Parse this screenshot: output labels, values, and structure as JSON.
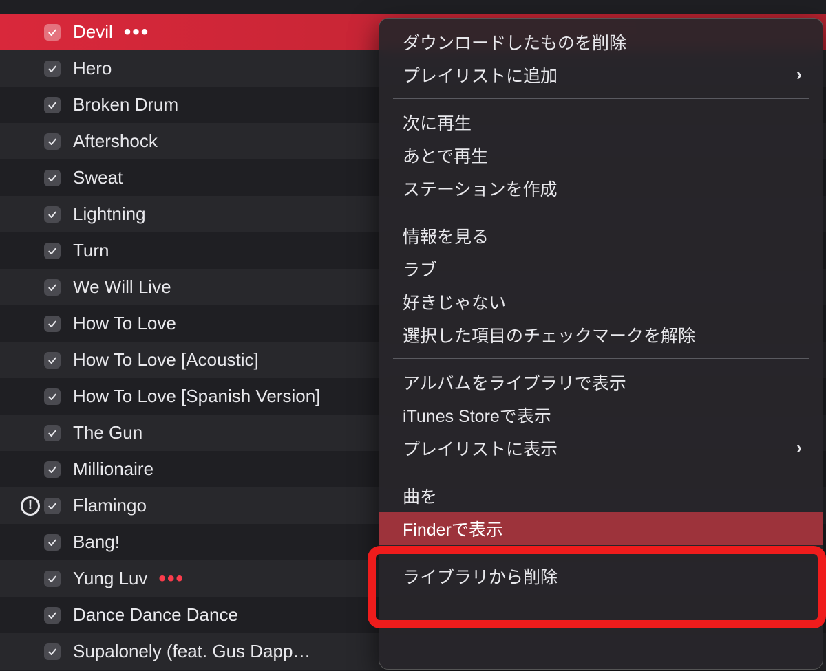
{
  "tracks": [
    {
      "title": "Devil",
      "checked": true,
      "selected": true,
      "ellipsis": true,
      "ellipsisRed": false,
      "warning": false
    },
    {
      "title": "Hero",
      "checked": true,
      "selected": false,
      "ellipsis": false,
      "warning": false
    },
    {
      "title": "Broken Drum",
      "checked": true,
      "selected": false,
      "ellipsis": false,
      "warning": false
    },
    {
      "title": "Aftershock",
      "checked": true,
      "selected": false,
      "ellipsis": false,
      "warning": false
    },
    {
      "title": "Sweat",
      "checked": true,
      "selected": false,
      "ellipsis": false,
      "warning": false
    },
    {
      "title": "Lightning",
      "checked": true,
      "selected": false,
      "ellipsis": false,
      "warning": false
    },
    {
      "title": "Turn",
      "checked": true,
      "selected": false,
      "ellipsis": false,
      "warning": false
    },
    {
      "title": "We Will Live",
      "checked": true,
      "selected": false,
      "ellipsis": false,
      "warning": false
    },
    {
      "title": "How To Love",
      "checked": true,
      "selected": false,
      "ellipsis": false,
      "warning": false
    },
    {
      "title": "How To Love [Acoustic]",
      "checked": true,
      "selected": false,
      "ellipsis": false,
      "warning": false
    },
    {
      "title": "How To Love [Spanish Version]",
      "checked": true,
      "selected": false,
      "ellipsis": false,
      "warning": false
    },
    {
      "title": "The Gun",
      "checked": true,
      "selected": false,
      "ellipsis": false,
      "warning": false
    },
    {
      "title": "Millionaire",
      "checked": true,
      "selected": false,
      "ellipsis": false,
      "warning": false
    },
    {
      "title": "Flamingo",
      "checked": true,
      "selected": false,
      "ellipsis": false,
      "warning": true
    },
    {
      "title": "Bang!",
      "checked": true,
      "selected": false,
      "ellipsis": false,
      "warning": false
    },
    {
      "title": "Yung Luv",
      "checked": true,
      "selected": false,
      "ellipsis": true,
      "ellipsisRed": true,
      "warning": false
    },
    {
      "title": "Dance Dance Dance",
      "checked": true,
      "selected": false,
      "ellipsis": false,
      "warning": false
    },
    {
      "title": "Supalonely (feat. Gus Dapp…",
      "checked": true,
      "selected": false,
      "ellipsis": false,
      "warning": false
    }
  ],
  "contextMenu": {
    "groups": [
      [
        {
          "label": "ダウンロードしたものを削除",
          "submenu": false
        },
        {
          "label": "プレイリストに追加",
          "submenu": true
        }
      ],
      [
        {
          "label": "次に再生",
          "submenu": false
        },
        {
          "label": "あとで再生",
          "submenu": false
        },
        {
          "label": "ステーションを作成",
          "submenu": false
        }
      ],
      [
        {
          "label": "情報を見る",
          "submenu": false
        },
        {
          "label": "ラブ",
          "submenu": false
        },
        {
          "label": "好きじゃない",
          "submenu": false
        },
        {
          "label": "選択した項目のチェックマークを解除",
          "submenu": false
        }
      ],
      [
        {
          "label": "アルバムをライブラリで表示",
          "submenu": false
        },
        {
          "label": "iTunes Storeで表示",
          "submenu": false
        },
        {
          "label": "プレイリストに表示",
          "submenu": true
        }
      ],
      [
        {
          "label": "曲を",
          "submenu": false
        },
        {
          "label": "Finderで表示",
          "submenu": false,
          "highlight": true
        }
      ],
      [
        {
          "label": "ライブラリから削除",
          "submenu": false
        }
      ]
    ]
  },
  "glyphs": {
    "ellipsis": "•••",
    "chevron": "›",
    "warning": "!"
  }
}
